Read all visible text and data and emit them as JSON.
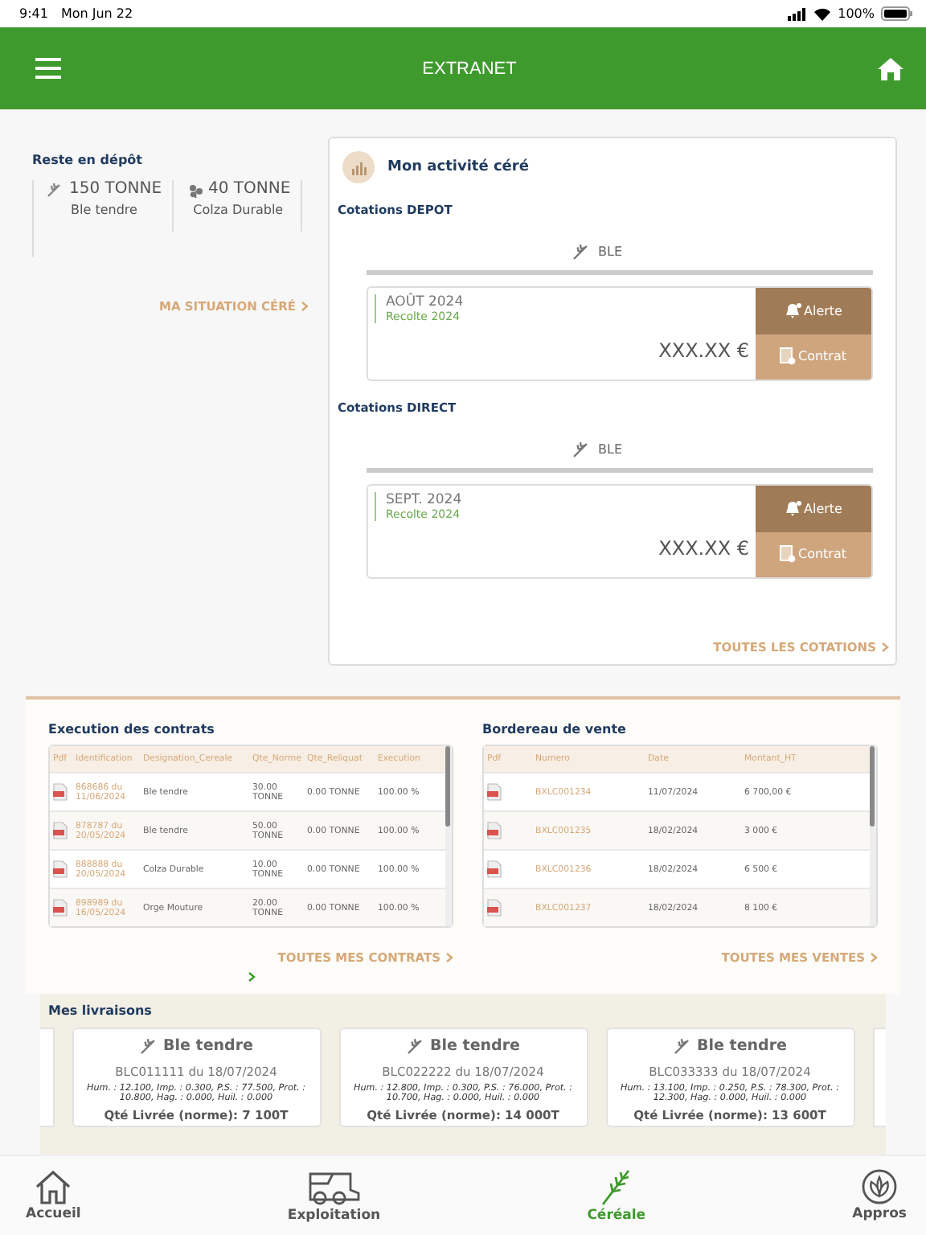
{
  "status_bar": {
    "time": "9:41",
    "date": "Mon Jun 22",
    "battery": "100%"
  },
  "header": {
    "title": "EXTRANET"
  },
  "stock": {
    "title": "Reste en dépôt",
    "items": [
      {
        "kind": "wheat",
        "amount": "150 TONNE",
        "label": "Ble tendre"
      },
      {
        "kind": "colza",
        "amount": "40 TONNE",
        "label": "Colza Durable"
      }
    ],
    "link": "MA SITUATION CÉRÉ"
  },
  "activity": {
    "title": "Mon activité céré",
    "sections": [
      {
        "title": "Cotations DEPOT",
        "crop": "BLE",
        "quote": {
          "month": "AOÛT 2024",
          "harvest": "Recolte 2024",
          "price": "XXX.XX €",
          "alert_button": "Alerte",
          "contract_button": "Contrat"
        }
      },
      {
        "title": "Cotations DIRECT",
        "crop": "BLE",
        "quote": {
          "month": "SEPT. 2024",
          "harvest": "Recolte 2024",
          "price": "XXX.XX €",
          "alert_button": "Alerte",
          "contract_button": "Contrat"
        }
      }
    ],
    "link": "TOUTES LES COTATIONS"
  },
  "contracts": {
    "title": "Execution des contrats",
    "columns": [
      "Pdf",
      "Identification",
      "Designation_Cereale",
      "Qte_Norme",
      "Qte_Reliquat",
      "Execution"
    ],
    "rows": [
      [
        "",
        "868686 du 11/06/2024",
        "Ble tendre",
        "30.00 TONNE",
        "0.00 TONNE",
        "100.00 %"
      ],
      [
        "",
        "878787 du 20/05/2024",
        "Ble tendre",
        "50.00 TONNE",
        "0.00 TONNE",
        "100.00 %"
      ],
      [
        "",
        "888888 du 20/05/2024",
        "Colza Durable",
        "10.00 TONNE",
        "0.00 TONNE",
        "100.00 %"
      ],
      [
        "",
        "898989 du 16/05/2024",
        "Orge Mouture",
        "20.00 TONNE",
        "0.00 TONNE",
        "100.00 %"
      ]
    ],
    "link": "TOUTES MES CONTRATS"
  },
  "sales": {
    "title": "Bordereau de vente",
    "columns": [
      "Pdf",
      "Numero",
      "Date",
      "Montant_HT"
    ],
    "rows": [
      [
        "",
        "BXLC001234",
        "11/07/2024",
        "6 700,00 €"
      ],
      [
        "",
        "BXLC001235",
        "18/02/2024",
        "3 000 €"
      ],
      [
        "",
        "BXLC001236",
        "18/02/2024",
        "6 500 €"
      ],
      [
        "",
        "BXLC001237",
        "18/02/2024",
        "8 100 €"
      ]
    ],
    "link": "TOUTES MES VENTES"
  },
  "deliveries": {
    "title": "Mes livraisons",
    "cards": [
      {
        "crop": "Ble tendre",
        "reference": "BLC011111 du 18/07/2024",
        "analysis": "Hum. : 12.100, Imp. : 0.300, P.S. : 77.500, Prot. : 10.800, Hag. : 0.000, Huil. : 0.000",
        "quantity": "Qté Livrée (norme): 7 100T"
      },
      {
        "crop": "Ble tendre",
        "reference": "BLC022222 du 18/07/2024",
        "analysis": "Hum. : 12.800, Imp. : 0.300, P.S. : 76.000, Prot. : 10.700, Hag. : 0.000, Huil. : 0.000",
        "quantity": "Qté Livrée (norme): 14 000T"
      },
      {
        "crop": "Ble tendre",
        "reference": "BLC033333 du 18/07/2024",
        "analysis": "Hum. : 13.100, Imp. : 0.250, P.S. : 78.300, Prot. : 12.300, Hag. : 0.000, Huil. : 0.000",
        "quantity": "Qté Livrée (norme): 13 600T"
      }
    ]
  },
  "tab_bar": [
    {
      "kind": "home",
      "label": "Accueil",
      "selected": false
    },
    {
      "kind": "harvester",
      "label": "Exploitation",
      "selected": false
    },
    {
      "kind": "wheat",
      "label": "Céréale",
      "selected": true
    },
    {
      "kind": "sprout",
      "label": "Appros",
      "selected": false
    }
  ]
}
